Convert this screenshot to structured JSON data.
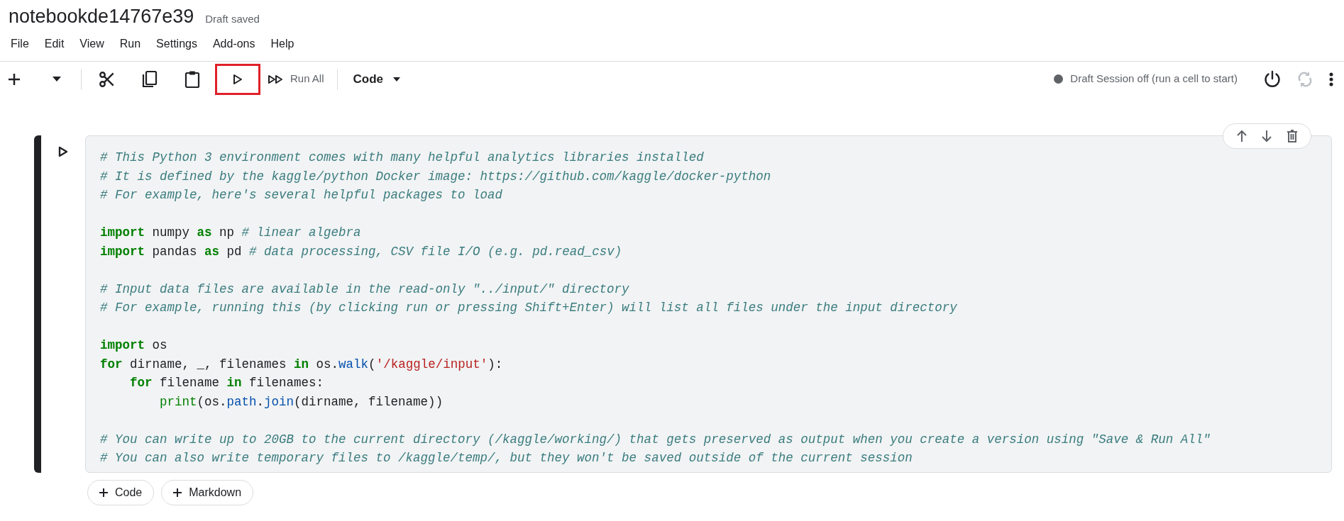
{
  "header": {
    "title": "notebookde14767e39",
    "save_status": "Draft saved"
  },
  "menu": [
    "File",
    "Edit",
    "View",
    "Run",
    "Settings",
    "Add-ons",
    "Help"
  ],
  "toolbar": {
    "run_cell_highlighted": true,
    "run_all_label": "Run All",
    "cell_type": "Code",
    "session": {
      "status": "Draft Session off (run a cell to start)",
      "active": false
    },
    "restart_disabled": true
  },
  "cell": {
    "blocks": [
      [
        [
          {
            "kind": "comment",
            "text": "# This Python 3 environment comes with many helpful analytics libraries installed"
          }
        ],
        [
          {
            "kind": "comment",
            "text": "# It is defined by the kaggle/python Docker image: https://github.com/kaggle/docker-python"
          }
        ],
        [
          {
            "kind": "comment",
            "text": "# For example, here's several helpful packages to load"
          }
        ]
      ],
      [
        [
          {
            "kind": "keyword",
            "text": "import"
          },
          {
            "kind": "plain",
            "text": " numpy "
          },
          {
            "kind": "keyword",
            "text": "as"
          },
          {
            "kind": "plain",
            "text": " np "
          },
          {
            "kind": "comment",
            "text": "# linear algebra"
          }
        ],
        [
          {
            "kind": "keyword",
            "text": "import"
          },
          {
            "kind": "plain",
            "text": " pandas "
          },
          {
            "kind": "keyword",
            "text": "as"
          },
          {
            "kind": "plain",
            "text": " pd "
          },
          {
            "kind": "comment",
            "text": "# data processing, CSV file I/O (e.g. pd.read_csv)"
          }
        ]
      ],
      [
        [
          {
            "kind": "comment",
            "text": "# Input data files are available in the read-only \"../input/\" directory"
          }
        ],
        [
          {
            "kind": "comment",
            "text": "# For example, running this (by clicking run or pressing Shift+Enter) will list all files under the input directory"
          }
        ]
      ],
      [
        [
          {
            "kind": "keyword",
            "text": "import"
          },
          {
            "kind": "plain",
            "text": " os"
          }
        ],
        [
          {
            "kind": "keyword",
            "text": "for"
          },
          {
            "kind": "plain",
            "text": " dirname, _, filenames "
          },
          {
            "kind": "keyword",
            "text": "in"
          },
          {
            "kind": "plain",
            "text": " os."
          },
          {
            "kind": "attr",
            "text": "walk"
          },
          {
            "kind": "plain",
            "text": "("
          },
          {
            "kind": "string",
            "text": "'/kaggle/input'"
          },
          {
            "kind": "plain",
            "text": "):"
          }
        ],
        [
          {
            "kind": "keyword",
            "text": "    for"
          },
          {
            "kind": "plain",
            "text": " filename "
          },
          {
            "kind": "keyword",
            "text": "in"
          },
          {
            "kind": "plain",
            "text": " filenames:"
          }
        ],
        [
          {
            "kind": "builtin",
            "text": "        print"
          },
          {
            "kind": "plain",
            "text": "(os."
          },
          {
            "kind": "attr",
            "text": "path"
          },
          {
            "kind": "plain",
            "text": "."
          },
          {
            "kind": "attr",
            "text": "join"
          },
          {
            "kind": "plain",
            "text": "(dirname, filename))"
          }
        ]
      ],
      [
        [
          {
            "kind": "comment",
            "text": "# You can write up to 20GB to the current directory (/kaggle/working/) that gets preserved as output when you create a version using \"Save & Run All\""
          }
        ],
        [
          {
            "kind": "comment",
            "text": "# You can also write temporary files to /kaggle/temp/, but they won't be saved outside of the current session"
          }
        ]
      ]
    ]
  },
  "add_buttons": [
    "Code",
    "Markdown"
  ]
}
